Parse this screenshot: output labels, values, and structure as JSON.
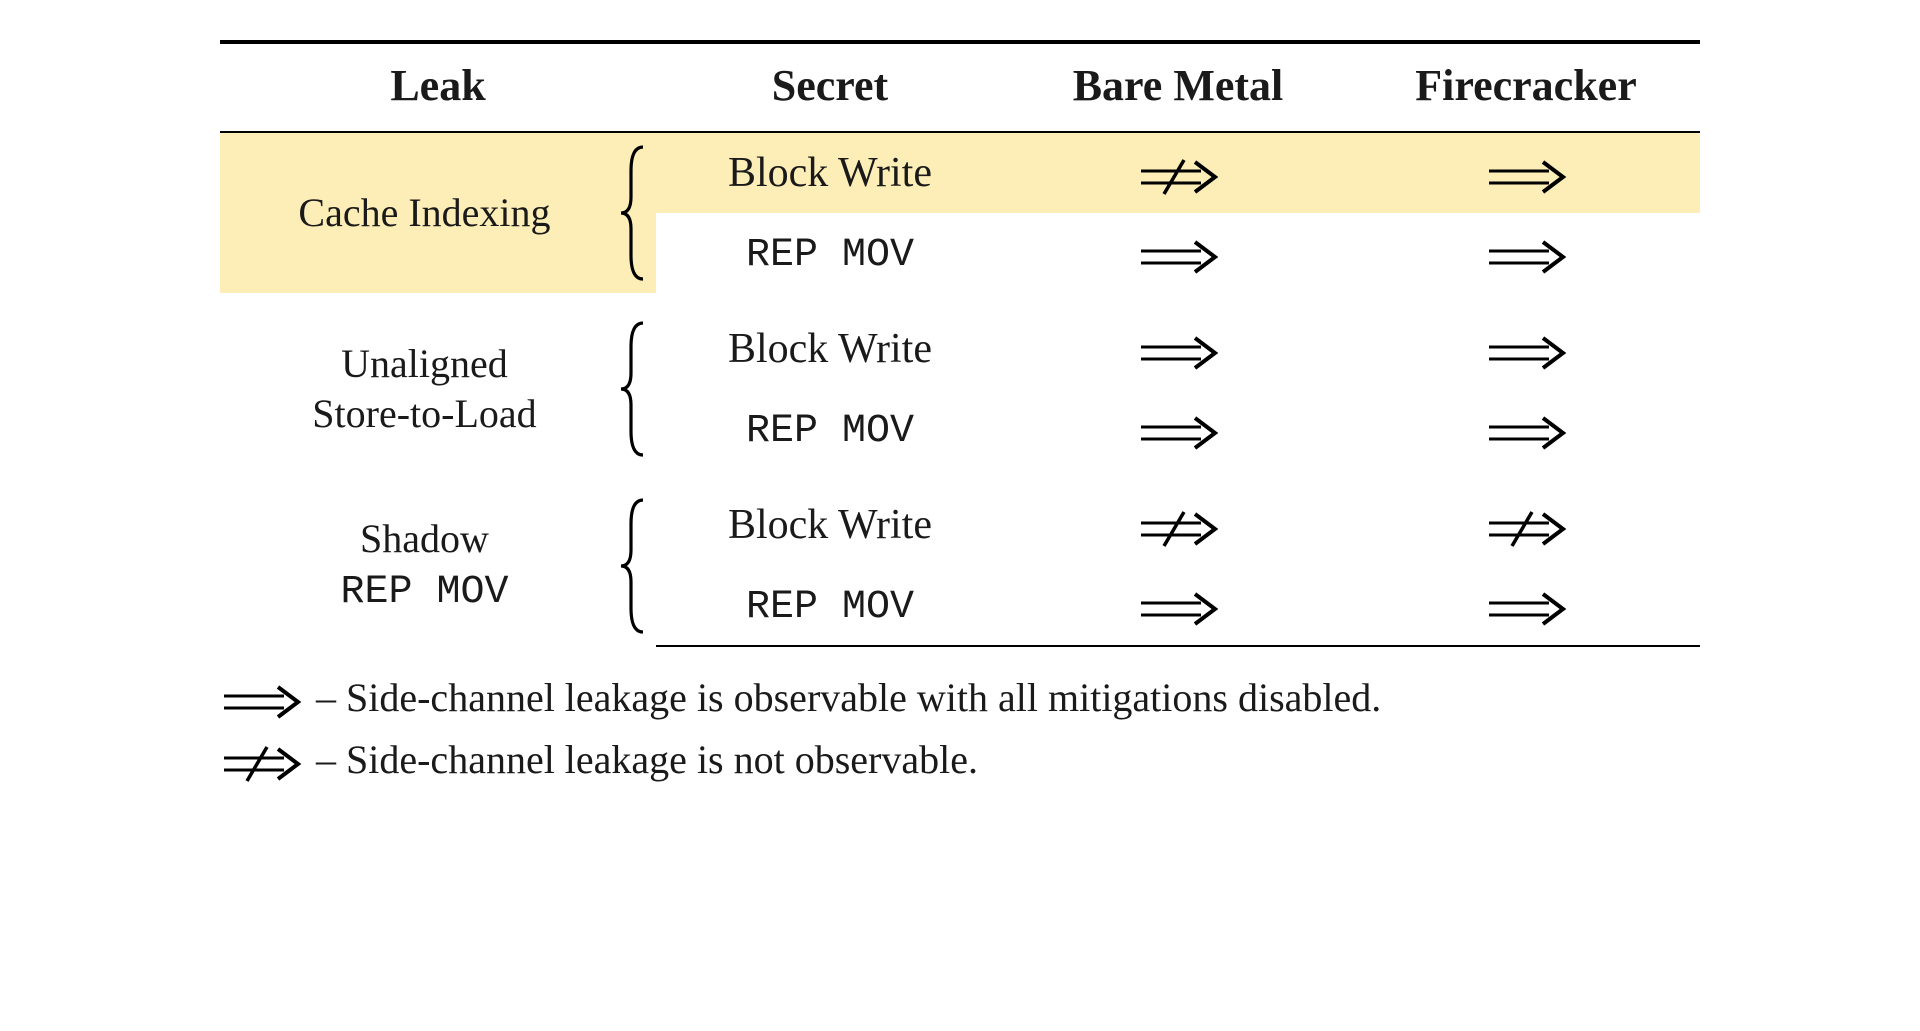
{
  "headers": {
    "leak": "Leak",
    "secret": "Secret",
    "bare_metal": "Bare Metal",
    "firecracker": "Firecracker"
  },
  "groups": [
    {
      "label_lines": [
        "Cache Indexing"
      ],
      "label_mono_line2": false,
      "rows": [
        {
          "secret": "Block Write",
          "secret_mono": false,
          "bare_metal": "not_observable",
          "firecracker": "observable",
          "highlight": true
        },
        {
          "secret": "REP MOV",
          "secret_mono": true,
          "bare_metal": "observable",
          "firecracker": "observable",
          "highlight": false
        }
      ]
    },
    {
      "label_lines": [
        "Unaligned",
        "Store-to-Load"
      ],
      "label_mono_line2": false,
      "rows": [
        {
          "secret": "Block Write",
          "secret_mono": false,
          "bare_metal": "observable",
          "firecracker": "observable",
          "highlight": false
        },
        {
          "secret": "REP MOV",
          "secret_mono": true,
          "bare_metal": "observable",
          "firecracker": "observable",
          "highlight": false
        }
      ]
    },
    {
      "label_lines": [
        "Shadow",
        "REP MOV"
      ],
      "label_mono_line2": true,
      "rows": [
        {
          "secret": "Block Write",
          "secret_mono": false,
          "bare_metal": "not_observable",
          "firecracker": "not_observable",
          "highlight": false
        },
        {
          "secret": "REP MOV",
          "secret_mono": true,
          "bare_metal": "observable",
          "firecracker": "observable",
          "highlight": false
        }
      ]
    }
  ],
  "legend": {
    "observable": "– Side-channel leakage is observable with all mitigations disabled.",
    "not_observable": "– Side-channel leakage is not observable."
  },
  "chart_data": {
    "type": "table",
    "columns": [
      "Leak",
      "Secret",
      "Bare Metal",
      "Firecracker"
    ],
    "symbol_meaning": {
      "observable": "Side-channel leakage is observable with all mitigations disabled.",
      "not_observable": "Side-channel leakage is not observable."
    },
    "rows": [
      {
        "Leak": "Cache Indexing",
        "Secret": "Block Write",
        "Bare Metal": "not_observable",
        "Firecracker": "observable",
        "highlighted": true
      },
      {
        "Leak": "Cache Indexing",
        "Secret": "REP MOV",
        "Bare Metal": "observable",
        "Firecracker": "observable",
        "highlighted": false
      },
      {
        "Leak": "Unaligned Store-to-Load",
        "Secret": "Block Write",
        "Bare Metal": "observable",
        "Firecracker": "observable",
        "highlighted": false
      },
      {
        "Leak": "Unaligned Store-to-Load",
        "Secret": "REP MOV",
        "Bare Metal": "observable",
        "Firecracker": "observable",
        "highlighted": false
      },
      {
        "Leak": "Shadow REP MOV",
        "Secret": "Block Write",
        "Bare Metal": "not_observable",
        "Firecracker": "not_observable",
        "highlighted": false
      },
      {
        "Leak": "Shadow REP MOV",
        "Secret": "REP MOV",
        "Bare Metal": "observable",
        "Firecracker": "observable",
        "highlighted": false
      }
    ]
  }
}
